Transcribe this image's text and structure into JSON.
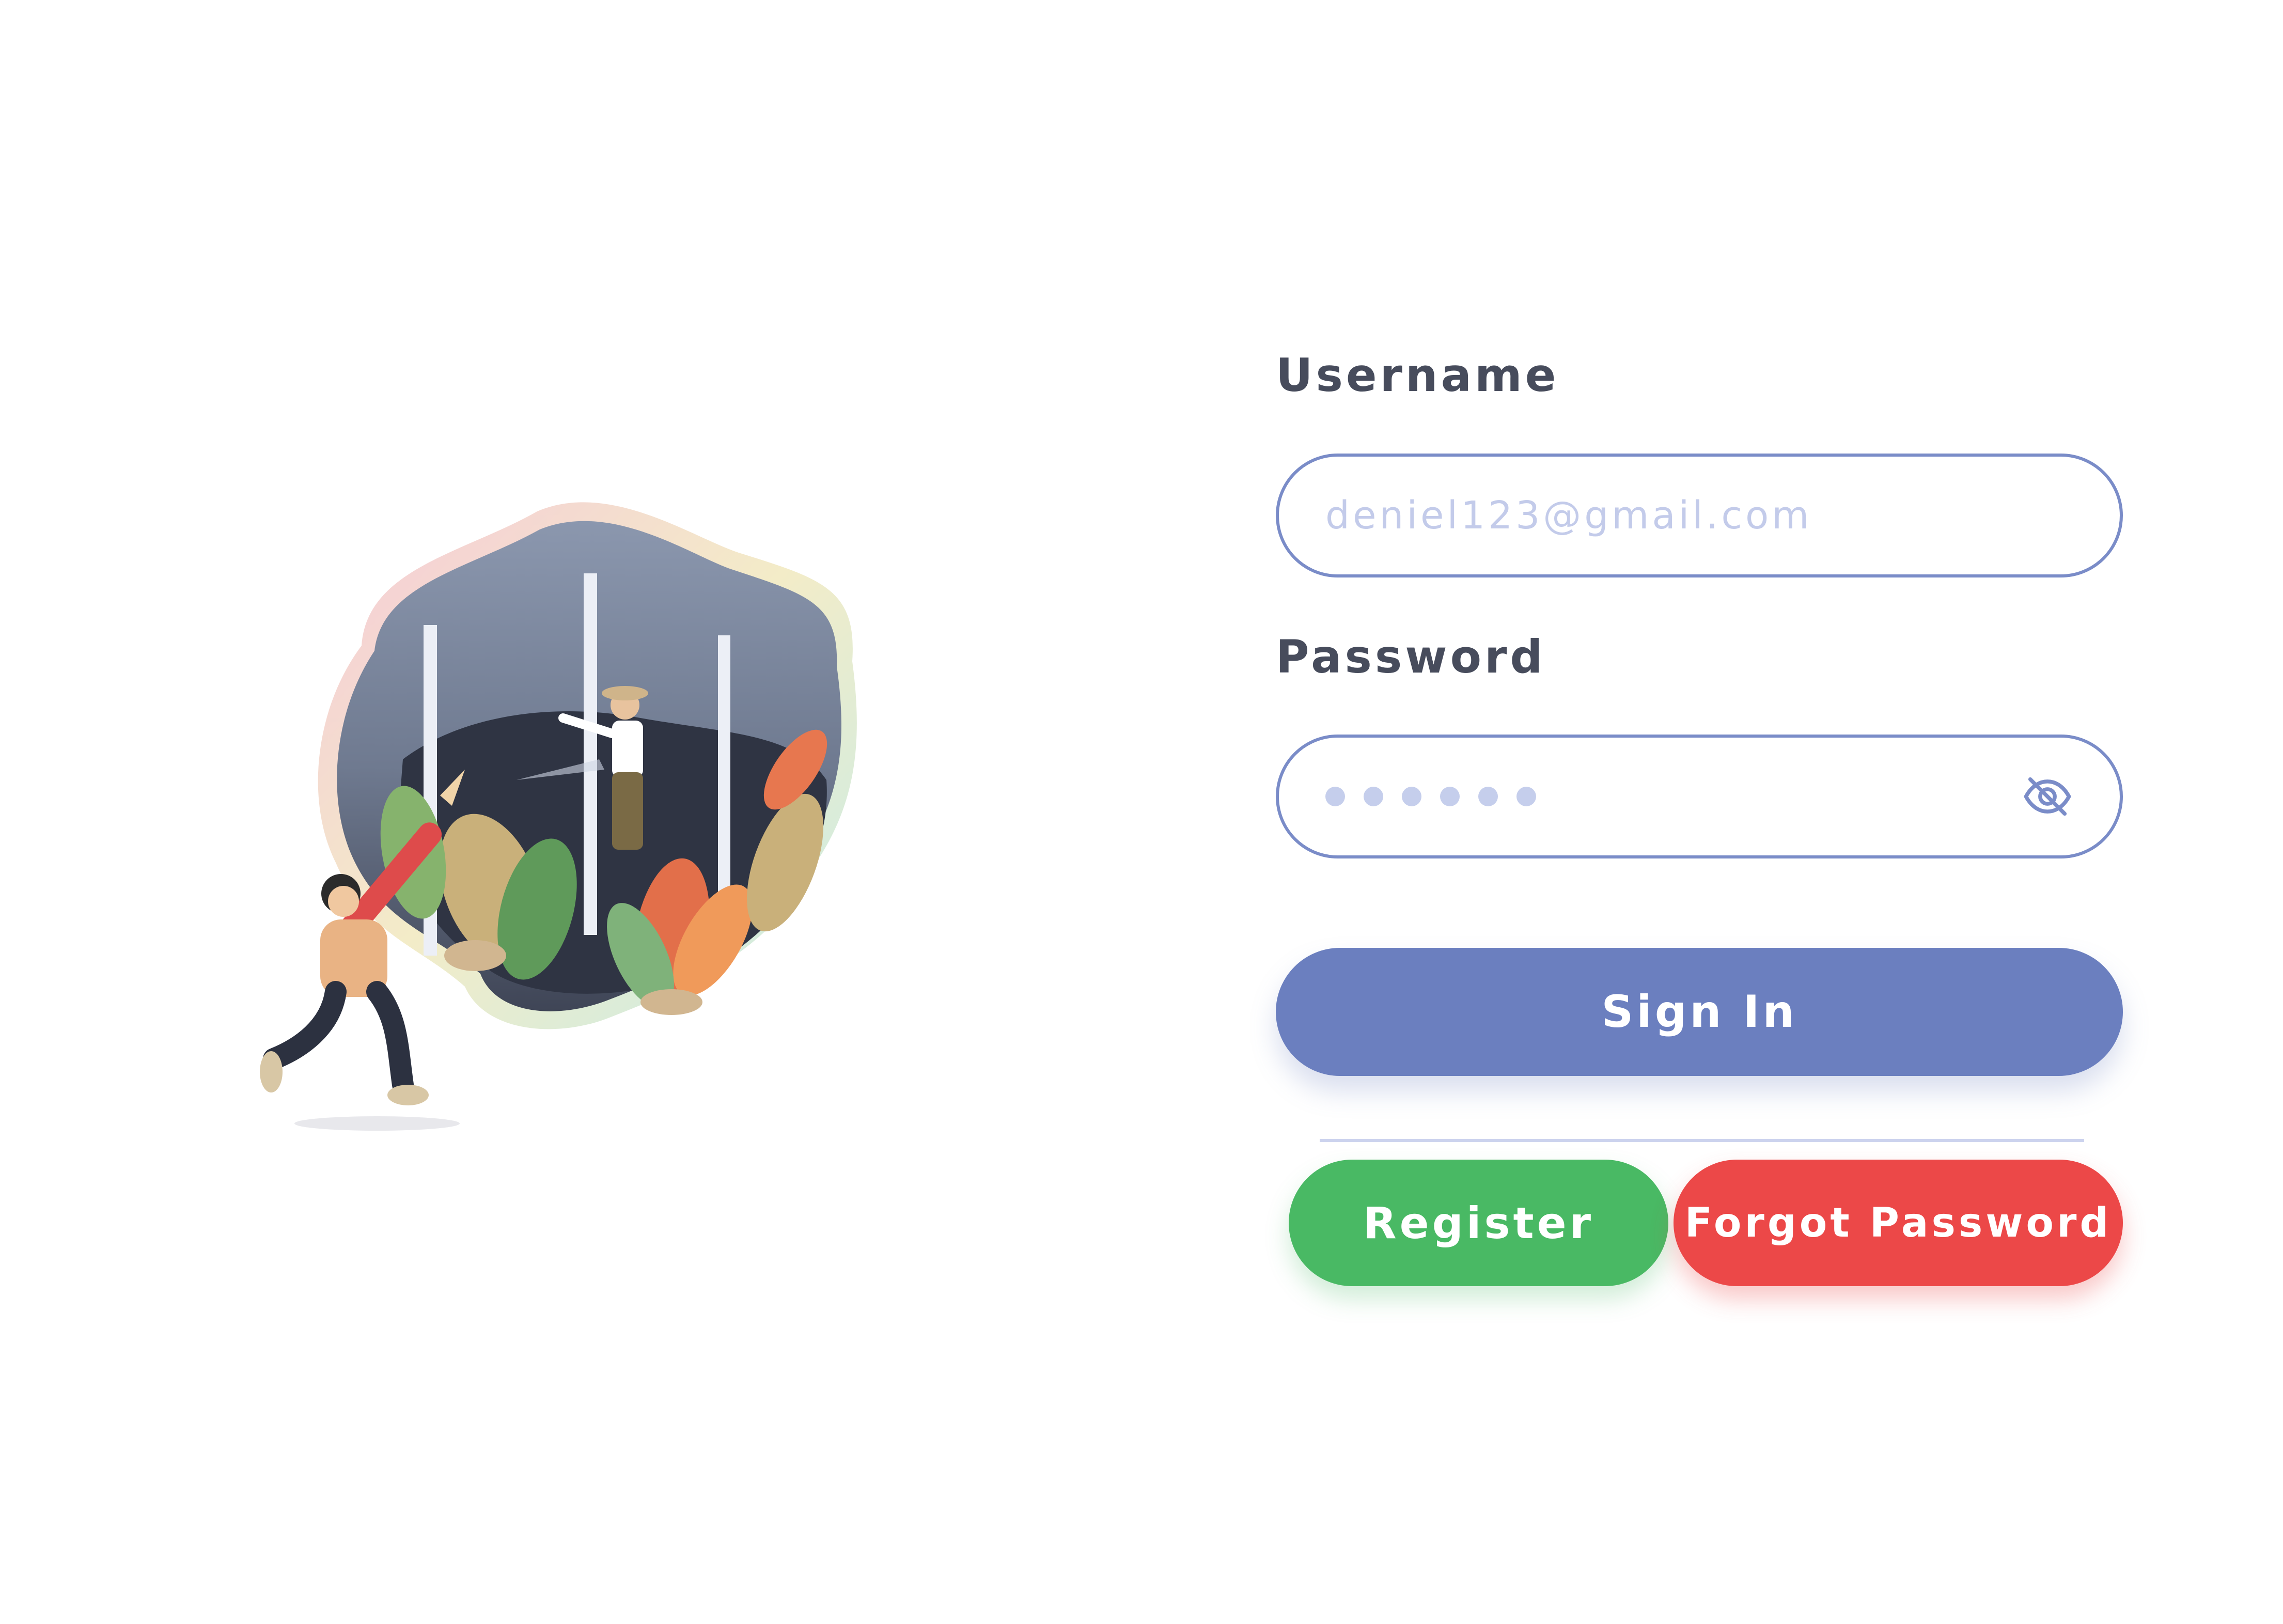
{
  "username": {
    "label": "Username",
    "placeholder": "deniel123@gmail.com"
  },
  "password": {
    "label": "Password",
    "masked_length": 6,
    "toggle_icon": "eye-slash-icon"
  },
  "buttons": {
    "signin": "Sign In",
    "register": "Register",
    "forgot": "Forgot Password"
  },
  "colors": {
    "primary": "#6b7fbf",
    "field_border": "#7a8cc8",
    "register": "#49b964",
    "forgot": "#ec4848",
    "label_text": "#474c5c"
  }
}
